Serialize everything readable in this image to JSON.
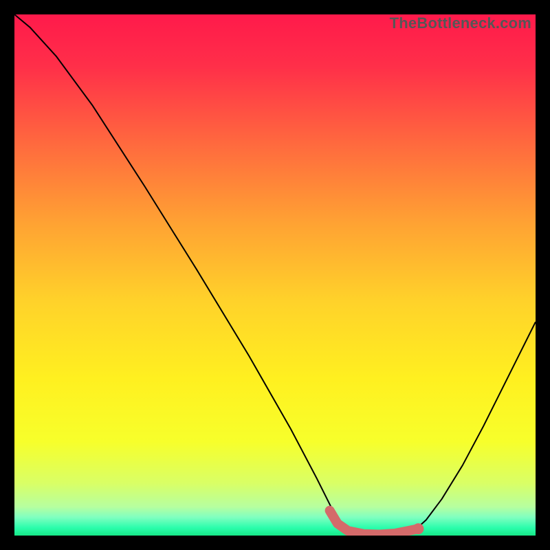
{
  "watermark": "TheBottleneck.com",
  "chart_data": {
    "type": "line",
    "title": "",
    "xlabel": "",
    "ylabel": "",
    "x_range": [
      0,
      100
    ],
    "y_range": [
      0,
      100
    ],
    "gradient_stops": [
      {
        "pos": 0.0,
        "color": "#ff1a4b"
      },
      {
        "pos": 0.1,
        "color": "#ff2f49"
      },
      {
        "pos": 0.25,
        "color": "#ff6a3e"
      },
      {
        "pos": 0.4,
        "color": "#ffa233"
      },
      {
        "pos": 0.55,
        "color": "#ffd22a"
      },
      {
        "pos": 0.7,
        "color": "#fff020"
      },
      {
        "pos": 0.82,
        "color": "#f7ff2b"
      },
      {
        "pos": 0.9,
        "color": "#d9ff66"
      },
      {
        "pos": 0.945,
        "color": "#b6ffa0"
      },
      {
        "pos": 0.965,
        "color": "#7fffc0"
      },
      {
        "pos": 0.985,
        "color": "#2bfdac"
      },
      {
        "pos": 1.0,
        "color": "#16e887"
      }
    ],
    "series": [
      {
        "name": "bottleneck-curve",
        "stroke": "#000000",
        "stroke_width": 2,
        "points": [
          {
            "x": 0.0,
            "y": 100.0
          },
          {
            "x": 3.0,
            "y": 97.5
          },
          {
            "x": 8.0,
            "y": 92.0
          },
          {
            "x": 15.0,
            "y": 82.5
          },
          {
            "x": 25.0,
            "y": 67.0
          },
          {
            "x": 35.0,
            "y": 51.0
          },
          {
            "x": 45.0,
            "y": 34.5
          },
          {
            "x": 53.0,
            "y": 20.5
          },
          {
            "x": 58.0,
            "y": 11.0
          },
          {
            "x": 61.0,
            "y": 5.0
          },
          {
            "x": 63.0,
            "y": 2.0
          },
          {
            "x": 65.0,
            "y": 0.5
          },
          {
            "x": 70.0,
            "y": 0.0
          },
          {
            "x": 75.0,
            "y": 0.5
          },
          {
            "x": 77.0,
            "y": 1.2
          },
          {
            "x": 79.0,
            "y": 3.0
          },
          {
            "x": 82.0,
            "y": 7.0
          },
          {
            "x": 86.0,
            "y": 13.5
          },
          {
            "x": 90.0,
            "y": 21.0
          },
          {
            "x": 95.0,
            "y": 31.0
          },
          {
            "x": 100.0,
            "y": 41.0
          }
        ]
      },
      {
        "name": "highlight-band",
        "stroke": "#d46a6a",
        "stroke_width": 14,
        "linecap": "round",
        "points": [
          {
            "x": 60.5,
            "y": 4.8
          },
          {
            "x": 62.0,
            "y": 2.3
          },
          {
            "x": 64.0,
            "y": 0.9
          },
          {
            "x": 67.0,
            "y": 0.3
          },
          {
            "x": 70.0,
            "y": 0.2
          },
          {
            "x": 73.0,
            "y": 0.4
          },
          {
            "x": 75.5,
            "y": 0.9
          },
          {
            "x": 77.5,
            "y": 1.3
          }
        ]
      },
      {
        "name": "highlight-dot",
        "type": "point",
        "fill": "#d46a6a",
        "radius": 8,
        "points": [
          {
            "x": 77.5,
            "y": 1.3
          }
        ]
      }
    ]
  }
}
